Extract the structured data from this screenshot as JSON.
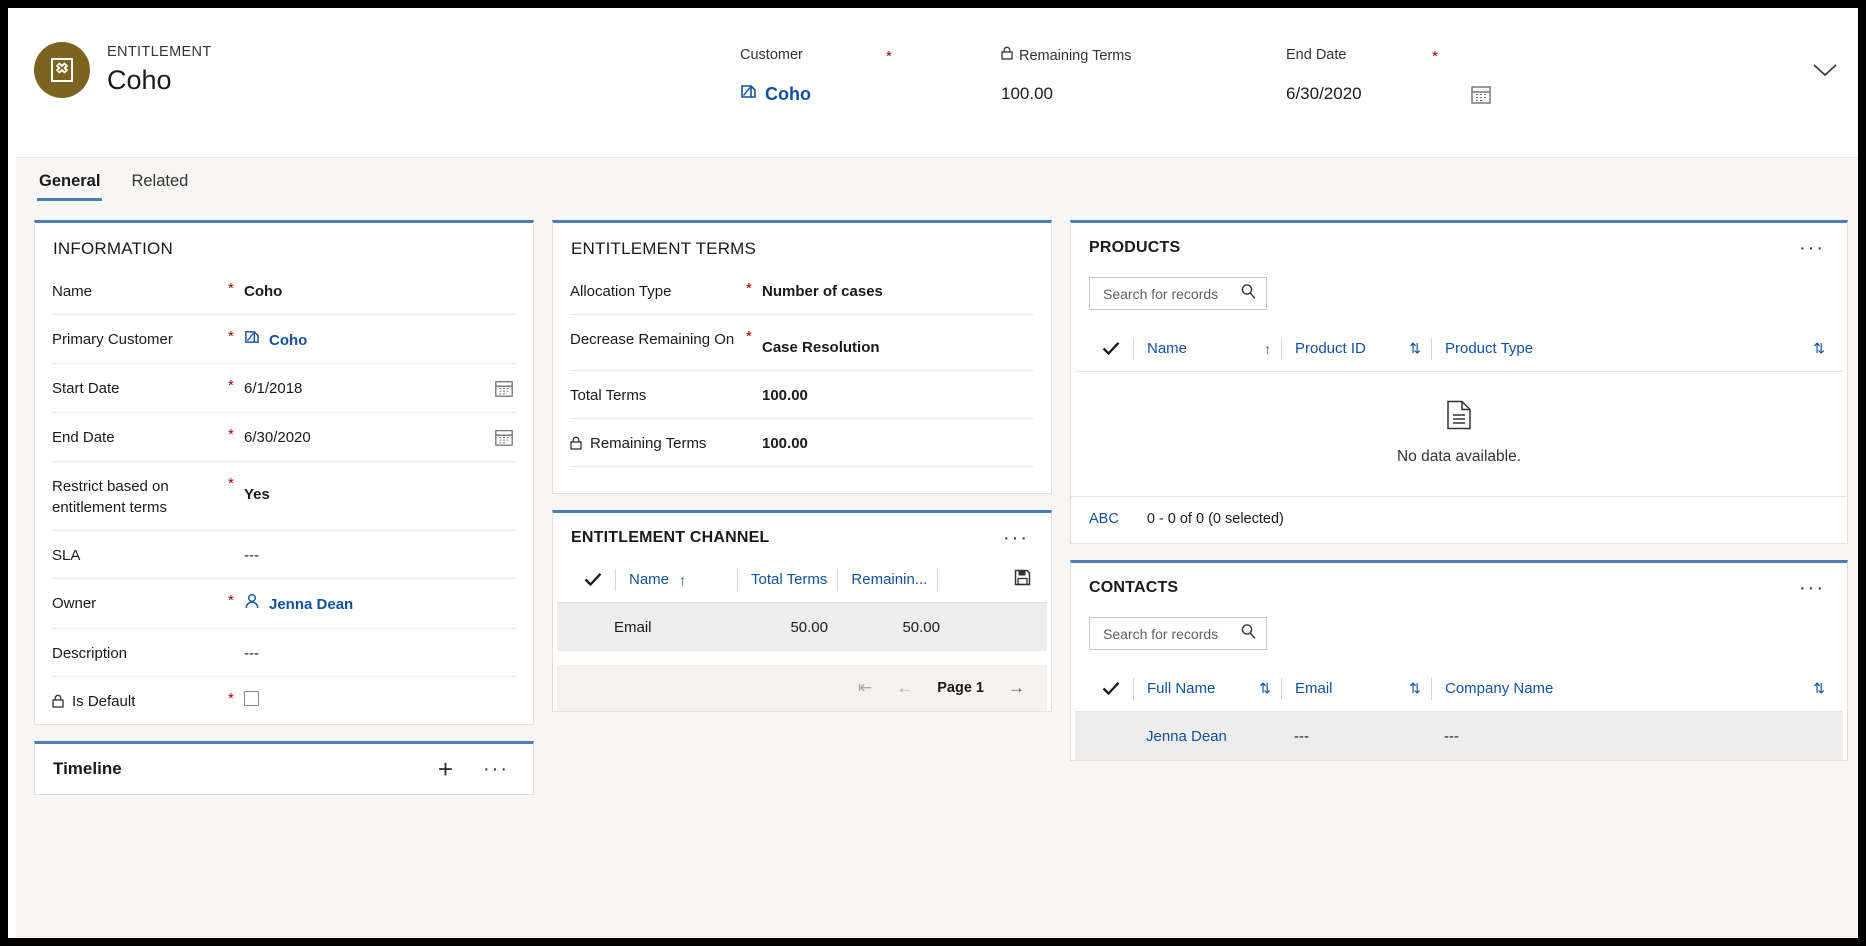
{
  "header": {
    "eyebrow": "ENTITLEMENT",
    "record_name": "Coho",
    "avatar_color": "#7a6420",
    "avatar_icon": "entitlement-icon",
    "fields": [
      {
        "label": "Customer",
        "required": true,
        "value": "Coho",
        "type": "lookup",
        "icon": "account-icon"
      },
      {
        "label": "Remaining Terms",
        "required": false,
        "value": "100.00",
        "type": "text",
        "locked": true
      },
      {
        "label": "End Date",
        "required": true,
        "value": "6/30/2020",
        "type": "date",
        "icon": "calendar-icon"
      }
    ],
    "collapse_icon": "chevron-down-icon"
  },
  "tabs": [
    {
      "label": "General",
      "active": true
    },
    {
      "label": "Related",
      "active": false
    }
  ],
  "information": {
    "title": "INFORMATION",
    "rows": [
      {
        "label": "Name",
        "required": true,
        "value": "Coho"
      },
      {
        "label": "Primary Customer",
        "required": true,
        "value": "Coho",
        "kind": "lookup",
        "icon": "account-icon"
      },
      {
        "label": "Start Date",
        "required": true,
        "value": "6/1/2018",
        "kind": "date"
      },
      {
        "label": "End Date",
        "required": true,
        "value": "6/30/2020",
        "kind": "date"
      },
      {
        "label": "Restrict based on entitlement terms",
        "required": true,
        "value": "Yes"
      },
      {
        "label": "SLA",
        "required": false,
        "value": "---",
        "kind": "empty"
      },
      {
        "label": "Owner",
        "required": true,
        "value": "Jenna Dean",
        "kind": "user",
        "icon": "person-icon"
      },
      {
        "label": "Description",
        "required": false,
        "value": "---",
        "kind": "empty"
      },
      {
        "label": "Is Default",
        "required": true,
        "value": "",
        "kind": "checkbox",
        "checked": false,
        "locked": true
      }
    ]
  },
  "timeline": {
    "title": "Timeline",
    "add_icon": "plus-icon",
    "more_icon": "ellipsis-icon"
  },
  "entitlement_terms": {
    "title": "ENTITLEMENT TERMS",
    "rows": [
      {
        "label": "Allocation Type",
        "required": true,
        "value": "Number of cases"
      },
      {
        "label": "Decrease Remaining On",
        "required": true,
        "value": "Case Resolution"
      },
      {
        "label": "Total Terms",
        "required": false,
        "value": "100.00"
      },
      {
        "label": "Remaining Terms",
        "required": false,
        "value": "100.00",
        "locked": true
      }
    ]
  },
  "entitlement_channel": {
    "title": "ENTITLEMENT CHANNEL",
    "more_icon": "ellipsis-icon",
    "save_icon": "save-icon",
    "columns": [
      {
        "label": "Name",
        "sort": "asc"
      },
      {
        "label": "Total Terms",
        "sort": "none"
      },
      {
        "label": "Remainin...",
        "sort": "none"
      }
    ],
    "rows": [
      {
        "name": "Email",
        "total_terms": "50.00",
        "remaining_terms": "50.00"
      }
    ],
    "pagination": {
      "first_icon": "page-first-icon",
      "prev_icon": "page-prev-icon",
      "label": "Page 1",
      "next_icon": "page-next-icon"
    }
  },
  "products": {
    "title": "PRODUCTS",
    "more_icon": "ellipsis-icon",
    "search_placeholder": "Search for records",
    "search_value": "",
    "search_icon": "search-icon",
    "columns": [
      {
        "label": "Name",
        "sort": "asc"
      },
      {
        "label": "Product ID",
        "sort": "none"
      },
      {
        "label": "Product Type",
        "sort": "none"
      }
    ],
    "empty_message": "No data available.",
    "empty_icon": "document-icon",
    "footer": {
      "abc": "ABC",
      "status": "0 - 0 of 0 (0 selected)"
    }
  },
  "contacts": {
    "title": "CONTACTS",
    "more_icon": "ellipsis-icon",
    "search_placeholder": "Search for records",
    "search_value": "",
    "search_icon": "search-icon",
    "columns": [
      {
        "label": "Full Name",
        "sort": "none"
      },
      {
        "label": "Email",
        "sort": "none"
      },
      {
        "label": "Company Name",
        "sort": "none"
      }
    ],
    "rows": [
      {
        "full_name": "Jenna Dean",
        "email": "---",
        "company_name": "---"
      }
    ]
  },
  "colors": {
    "accent": "#4a7eb5",
    "link": "#13509c",
    "required": "#a80000",
    "avatar": "#7a6420",
    "panel_bg": "#f7f6f5"
  }
}
